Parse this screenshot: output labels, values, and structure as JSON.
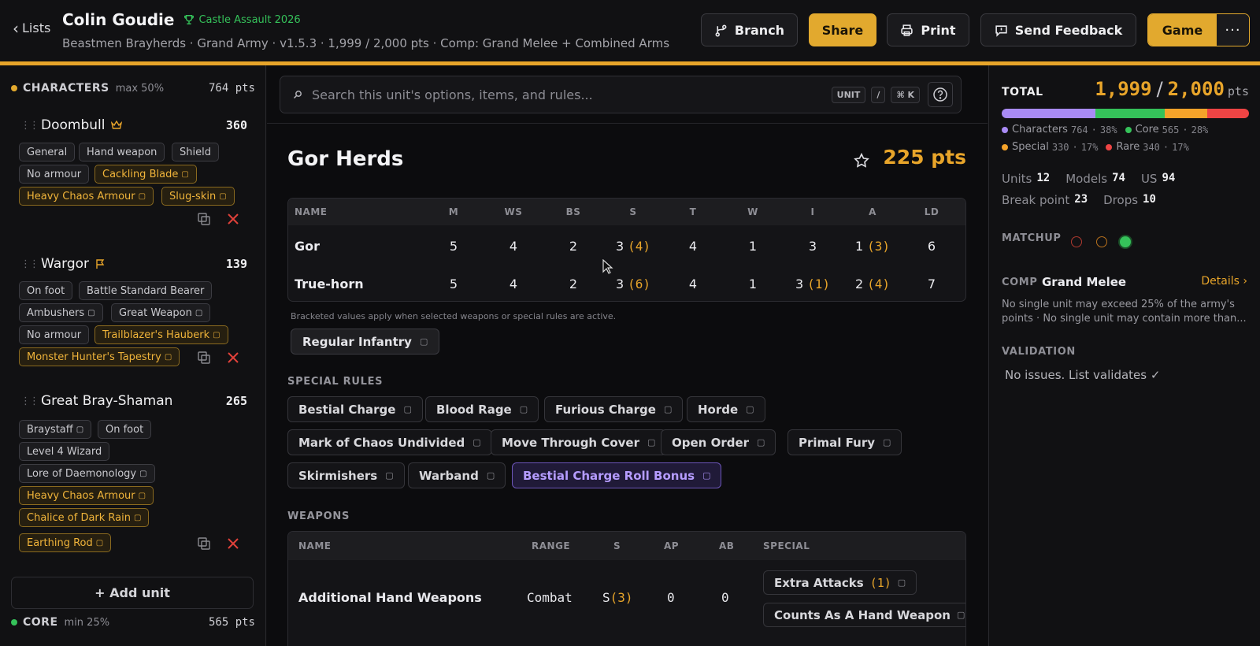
{
  "header": {
    "back_label": "Lists",
    "title": "Colin Goudie",
    "event": "Castle Assault 2026",
    "subtitle": "Beastmen Brayherds · Grand Army · v1.5.3 · 1,999 / 2,000 pts · Comp: Grand Melee + Combined Arms",
    "buttons": {
      "branch": "Branch",
      "share": "Share",
      "print": "Print",
      "feedback": "Send Feedback",
      "game": "Game",
      "more": "···"
    },
    "accent_color": "#e2a92e"
  },
  "sidebar": {
    "characters": {
      "name": "CHARACTERS",
      "limit": "max 50%",
      "pts": "764 pts",
      "color": "#e2a92e"
    },
    "units": [
      {
        "name": "Doombull",
        "pts": "360",
        "chips": [
          "General",
          "Hand weapon",
          "Shield",
          "No armour",
          "Cackling Blade",
          "Heavy Chaos Armour",
          "Slug-skin"
        ]
      },
      {
        "name": "Wargor",
        "pts": "139",
        "chips": [
          "On foot",
          "Battle Standard Bearer",
          "Ambushers",
          "Great Weapon",
          "No armour",
          "Trailblazer's Hauberk",
          "Monster Hunter's Tapestry"
        ]
      },
      {
        "name": "Great Bray-Shaman",
        "pts": "265",
        "chips": [
          "Braystaff",
          "On foot",
          "Level 4 Wizard",
          "Lore of Daemonology",
          "Heavy Chaos Armour",
          "Chalice of Dark Rain",
          "Earthing Rod"
        ]
      }
    ],
    "add_unit": "+ Add unit",
    "core": {
      "name": "CORE",
      "limit": "min 25%",
      "pts": "565 pts",
      "color": "#35c25a"
    }
  },
  "search": {
    "placeholder": "Search this unit's options, items, and rules...",
    "kbd_unit": "UNIT",
    "kbd_slash": "/",
    "kbd_cmd": "⌘ K"
  },
  "unit": {
    "title": "Gor Herds",
    "pts": "225 pts",
    "stat_headers": [
      "NAME",
      "M",
      "WS",
      "BS",
      "S",
      "T",
      "W",
      "I",
      "A",
      "LD"
    ],
    "stat_rows": [
      {
        "name": "Gor",
        "M": "5",
        "WS": "4",
        "BS": "2",
        "S": "3",
        "S_mod": "(4)",
        "T": "4",
        "W": "1",
        "I": "3",
        "I_mod": "",
        "A": "1",
        "A_mod": "(3)",
        "LD": "6"
      },
      {
        "name": "True-horn",
        "M": "5",
        "WS": "4",
        "BS": "2",
        "S": "3",
        "S_mod": "(6)",
        "T": "4",
        "W": "1",
        "I": "3",
        "I_mod": "(1)",
        "A": "2",
        "A_mod": "(4)",
        "LD": "7"
      }
    ],
    "note": "Bracketed values apply when selected weapons or special rules are active.",
    "troop_type": "Regular Infantry",
    "special_rules_label": "SPECIAL RULES",
    "special_rules": [
      "Bestial Charge",
      "Blood Rage",
      "Furious Charge",
      "Horde",
      "Mark of Chaos Undivided",
      "Move Through Cover",
      "Open Order",
      "Primal Fury",
      "Skirmishers",
      "Warband",
      "Bestial Charge Roll Bonus"
    ],
    "weapons_label": "WEAPONS",
    "weapon_headers": [
      "NAME",
      "RANGE",
      "S",
      "AP",
      "AB",
      "SPECIAL"
    ],
    "weapons": [
      {
        "name": "Additional Hand Weapons",
        "range": "Combat",
        "s": "S",
        "s_mod": "(3)",
        "ap": "0",
        "ab": "0",
        "special": [
          {
            "label": "Extra Attacks",
            "mod": "(1)"
          },
          {
            "label": "Counts As A Hand Weapon",
            "mod": ""
          }
        ]
      }
    ]
  },
  "summary": {
    "total_label": "TOTAL",
    "total": "1,999",
    "max": "2,000",
    "pts_unit": "pts",
    "categories": [
      {
        "name": "Characters",
        "pts": "764",
        "pct": "38%",
        "color": "#a98bf5",
        "share": 38
      },
      {
        "name": "Core",
        "pts": "565",
        "pct": "28%",
        "color": "#35c25a",
        "share": 28
      },
      {
        "name": "Special",
        "pts": "330",
        "pct": "17%",
        "color": "#f5a32a",
        "share": 17
      },
      {
        "name": "Rare",
        "pts": "340",
        "pct": "17%",
        "color": "#ee4444",
        "share": 17
      }
    ],
    "units_label": "Units",
    "units": "12",
    "models_label": "Models",
    "models": "74",
    "us_label": "US",
    "us": "94",
    "break_label": "Break point",
    "break": "23",
    "drops_label": "Drops",
    "drops": "10",
    "matchup_label": "MATCHUP",
    "matchup_colors": [
      "#c0392b",
      "#c77b1f",
      "#35c25a"
    ],
    "comp_label": "COMP",
    "comp_name": "Grand Melee",
    "comp_details": "Details ›",
    "comp_text": "No single unit may exceed 25% of the army's points · No single unit may contain more than...",
    "validation_label": "VALIDATION",
    "validation_text": "No issues. List validates ✓"
  }
}
